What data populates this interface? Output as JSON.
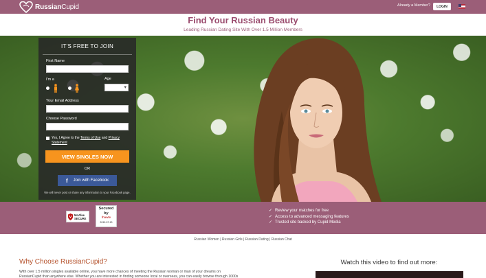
{
  "header": {
    "logo_text_bold": "Russian",
    "logo_text_rest": "Cupid",
    "already_member": "Already a Member?",
    "login_label": "LOGIN"
  },
  "headline": {
    "title": "Find Your Russian Beauty",
    "subtitle": "Leading Russian Dating Site With Over 1.5 Million Members"
  },
  "join_form": {
    "title": "IT'S FREE TO JOIN",
    "first_name_label": "First Name",
    "im_a_label": "I'm a",
    "age_label": "Age",
    "email_label": "Your Email Address",
    "password_label": "Choose Password",
    "agree_prefix": "Yes, I Agree to the ",
    "terms_link": "Terms of Use",
    "agree_and": " and ",
    "privacy_link": "Privacy Statement",
    "submit_label": "VIEW SINGLES NOW",
    "or_label": "OR",
    "facebook_label": "Join with Facebook",
    "facebook_note": "We will never post or share any information to your Facebook page."
  },
  "badges": {
    "mcafee_line1": "McAfee",
    "mcafee_line2": "SECURE",
    "secured_line1": "Secured",
    "secured_line2": "by",
    "secured_line3": "thawte",
    "secured_date": "2019-07-13"
  },
  "features": [
    "Review your matches for free",
    "Access to advanced messaging features",
    "Trusted site backed by Cupid Media"
  ],
  "links": [
    "Russian Women",
    "Russian Girls",
    "Russian Dating",
    "Russian Chat"
  ],
  "why": {
    "title": "Why Choose RussianCupid?",
    "text": "With over 1.5 million singles available online, you have more chances of meeting the Russian woman or man of your dreams on RussianCupid than anywhere else. Whether you are interested in finding someone local or overseas, you can easily browse through 1000s"
  },
  "video": {
    "title": "Watch this video to find out more:"
  },
  "colors": {
    "brand": "#9b5e78",
    "accent_orange": "#f7941e",
    "facebook": "#3b5998"
  }
}
